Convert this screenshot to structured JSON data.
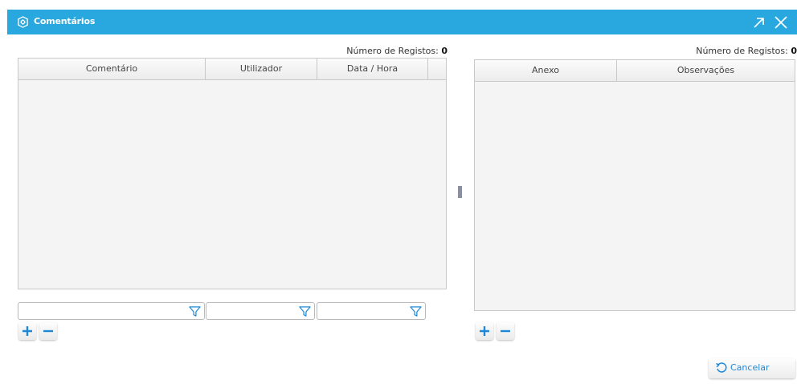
{
  "dialog": {
    "title": "Comentários",
    "icons": {
      "title": "cube-settings-icon",
      "maximize": "arrow-up-right-icon",
      "close": "close-icon"
    }
  },
  "comments_panel": {
    "count_label": "Número de Registos:",
    "count_value": "0",
    "columns": [
      "Comentário",
      "Utilizador",
      "Data / Hora"
    ],
    "filter_icon": "filter-icon"
  },
  "attachments_panel": {
    "count_label": "Número de Registos:",
    "count_value": "0",
    "columns": [
      "Anexo",
      "Observações"
    ]
  },
  "actions": {
    "cancel_label": "Cancelar",
    "cancel_icon": "undo-icon",
    "add_icon": "plus-icon",
    "remove_icon": "minus-icon"
  },
  "colors": {
    "titlebar": "#29a8e0",
    "accent": "#1e88d6",
    "grid_bg": "#f4f4f4"
  }
}
